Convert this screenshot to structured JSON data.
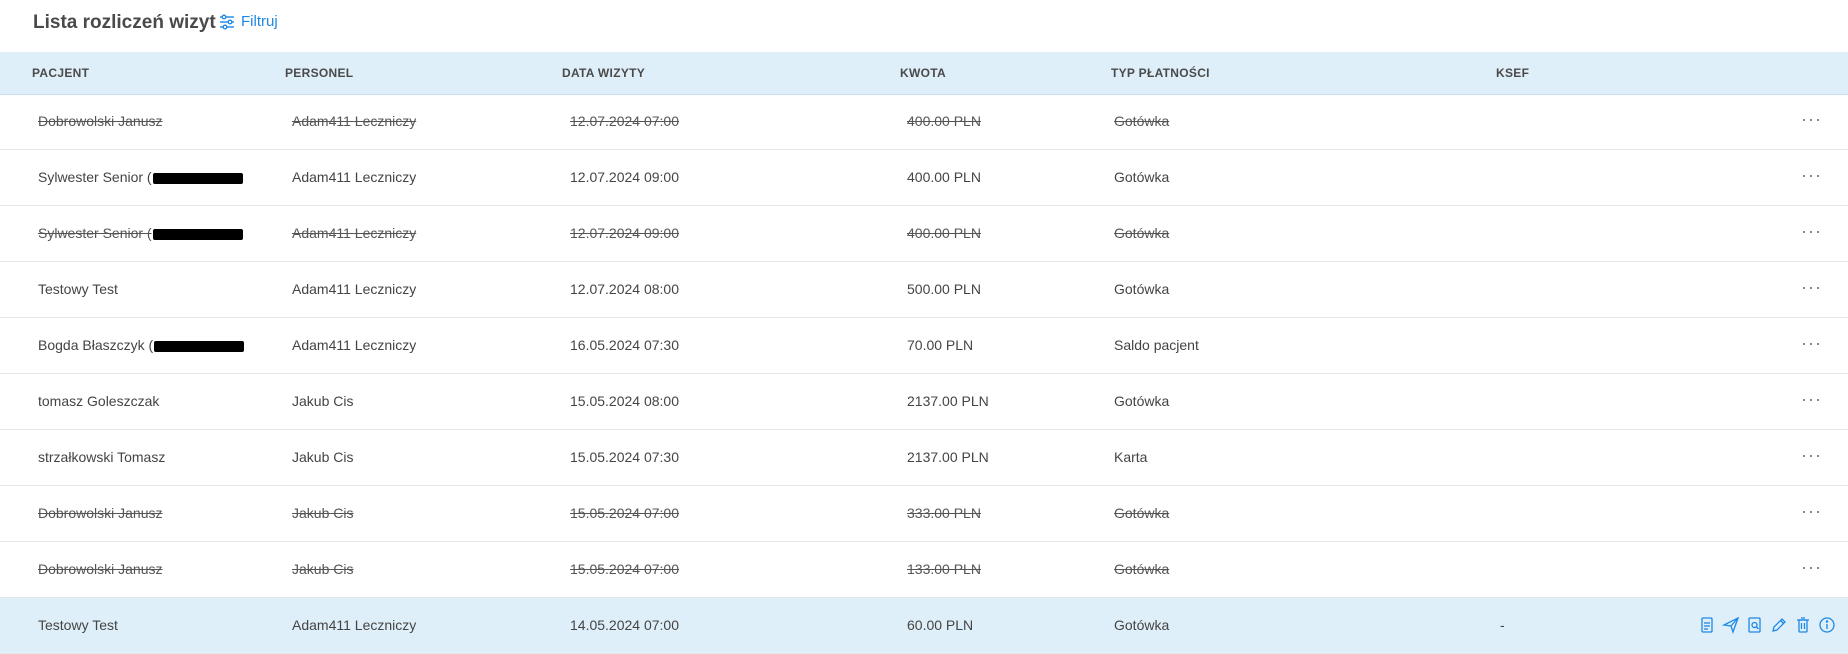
{
  "header": {
    "title": "Lista rozliczeń wizyt",
    "filter_label": "Filtruj"
  },
  "table": {
    "columns": [
      "PACJENT",
      "PERSONEL",
      "DATA WIZYTY",
      "KWOTA",
      "TYP PŁATNOŚCI",
      "KSEF"
    ],
    "rows": [
      {
        "patient": "Dobrowolski Janusz",
        "staff": "Adam411 Leczniczy",
        "date": "12.07.2024 07:00",
        "amount": "400.00 PLN",
        "payment": "Gotówka",
        "ksef": "",
        "cancelled": true
      },
      {
        "patient": "Sylwester Senior (",
        "staff": "Adam411 Leczniczy",
        "date": "12.07.2024 09:00",
        "amount": "400.00 PLN",
        "payment": "Gotówka",
        "ksef": "",
        "cancelled": false
      },
      {
        "patient": "Sylwester Senior (",
        "staff": "Adam411 Leczniczy",
        "date": "12.07.2024 09:00",
        "amount": "400.00 PLN",
        "payment": "Gotówka",
        "ksef": "",
        "cancelled": true
      },
      {
        "patient": "Testowy Test",
        "staff": "Adam411 Leczniczy",
        "date": "12.07.2024 08:00",
        "amount": "500.00 PLN",
        "payment": "Gotówka",
        "ksef": "",
        "cancelled": false
      },
      {
        "patient": "Bogda Błaszczyk (",
        "staff": "Adam411 Leczniczy",
        "date": "16.05.2024 07:30",
        "amount": "70.00 PLN",
        "payment": "Saldo pacjent",
        "ksef": "",
        "cancelled": false
      },
      {
        "patient": "tomasz Goleszczak",
        "staff": "Jakub Cis",
        "date": "15.05.2024 08:00",
        "amount": "2137.00 PLN",
        "payment": "Gotówka",
        "ksef": "",
        "cancelled": false
      },
      {
        "patient": "strzałkowski Tomasz",
        "staff": "Jakub Cis",
        "date": "15.05.2024 07:30",
        "amount": "2137.00 PLN",
        "payment": "Karta",
        "ksef": "",
        "cancelled": false
      },
      {
        "patient": "Dobrowolski Janusz",
        "staff": "Jakub Cis",
        "date": "15.05.2024 07:00",
        "amount": "333.00 PLN",
        "payment": "Gotówka",
        "ksef": "",
        "cancelled": true
      },
      {
        "patient": "Dobrowolski Janusz",
        "staff": "Jakub Cis",
        "date": "15.05.2024 07:00",
        "amount": "133.00 PLN",
        "payment": "Gotówka",
        "ksef": "",
        "cancelled": true
      },
      {
        "patient": "Testowy Test",
        "staff": "Adam411 Leczniczy",
        "date": "14.05.2024 07:00",
        "amount": "60.00 PLN",
        "payment": "Gotówka",
        "ksef": "-",
        "cancelled": false
      }
    ]
  },
  "row_menu_label": "···",
  "colors": {
    "accent": "#1e88e5",
    "header_bg": "#dfeff9"
  },
  "row_action_icons": [
    "document-icon",
    "send-icon",
    "preview-icon",
    "edit-icon",
    "trash-icon",
    "info-icon"
  ]
}
